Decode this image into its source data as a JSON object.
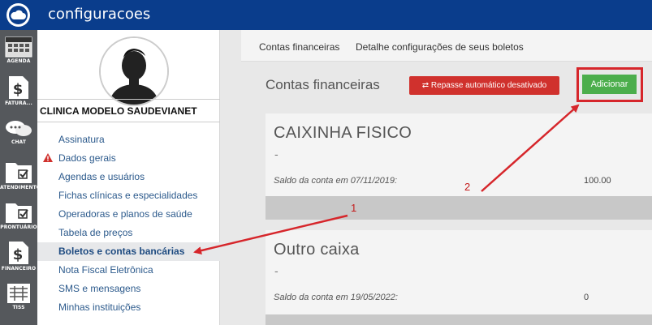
{
  "header": {
    "title": "configuracoes"
  },
  "iconbar": {
    "items": [
      {
        "label": "AGENDA",
        "icon": "calendar-icon"
      },
      {
        "label": "FATURA...",
        "icon": "dollar-doc-icon"
      },
      {
        "label": "CHAT",
        "icon": "chat-icon"
      },
      {
        "label": "ATENDIMENTO",
        "icon": "folder-check-icon"
      },
      {
        "label": "PRONTUÁRIO",
        "icon": "folder-check-icon"
      },
      {
        "label": "FINANCEIRO",
        "icon": "dollar-doc-icon"
      },
      {
        "label": "TISS",
        "icon": "tiss-icon"
      }
    ]
  },
  "profile": {
    "clinic_name": "CLINICA MODELO SAUDEVIANET"
  },
  "menu": {
    "items": [
      {
        "label": "Assinatura"
      },
      {
        "label": "Dados gerais",
        "warning": true
      },
      {
        "label": "Agendas e usuários"
      },
      {
        "label": "Fichas clínicas e especialidades"
      },
      {
        "label": "Operadoras e planos de saúde"
      },
      {
        "label": "Tabela de preços"
      },
      {
        "label": "Boletos e contas bancárias",
        "active": true
      },
      {
        "label": "Nota Fiscal Eletrônica"
      },
      {
        "label": "SMS e mensagens"
      },
      {
        "label": "Minhas instituições"
      }
    ]
  },
  "breadcrumb": {
    "tab1": "Contas financeiras",
    "tab2": "Detalhe configurações de seus boletos"
  },
  "main": {
    "heading": "Contas financeiras",
    "repasse_button": "⇄ Repasse automático desativado",
    "add_button": "Adicionar"
  },
  "accounts": [
    {
      "name": "CAIXINHA FISICO",
      "description": "-",
      "saldo_label": "Saldo da conta em 07/11/2019:",
      "saldo_value": "100.00"
    },
    {
      "name": "Outro caixa",
      "description": "-",
      "saldo_label": "Saldo da conta em 19/05/2022:",
      "saldo_value": "0"
    }
  ],
  "annotations": {
    "label1": "1",
    "label2": "2",
    "color": "#d6262b"
  },
  "colors": {
    "header_bg": "#0a3d8c",
    "sidebar_bg": "#55585c",
    "danger": "#d0312d",
    "success": "#4cae4c"
  }
}
